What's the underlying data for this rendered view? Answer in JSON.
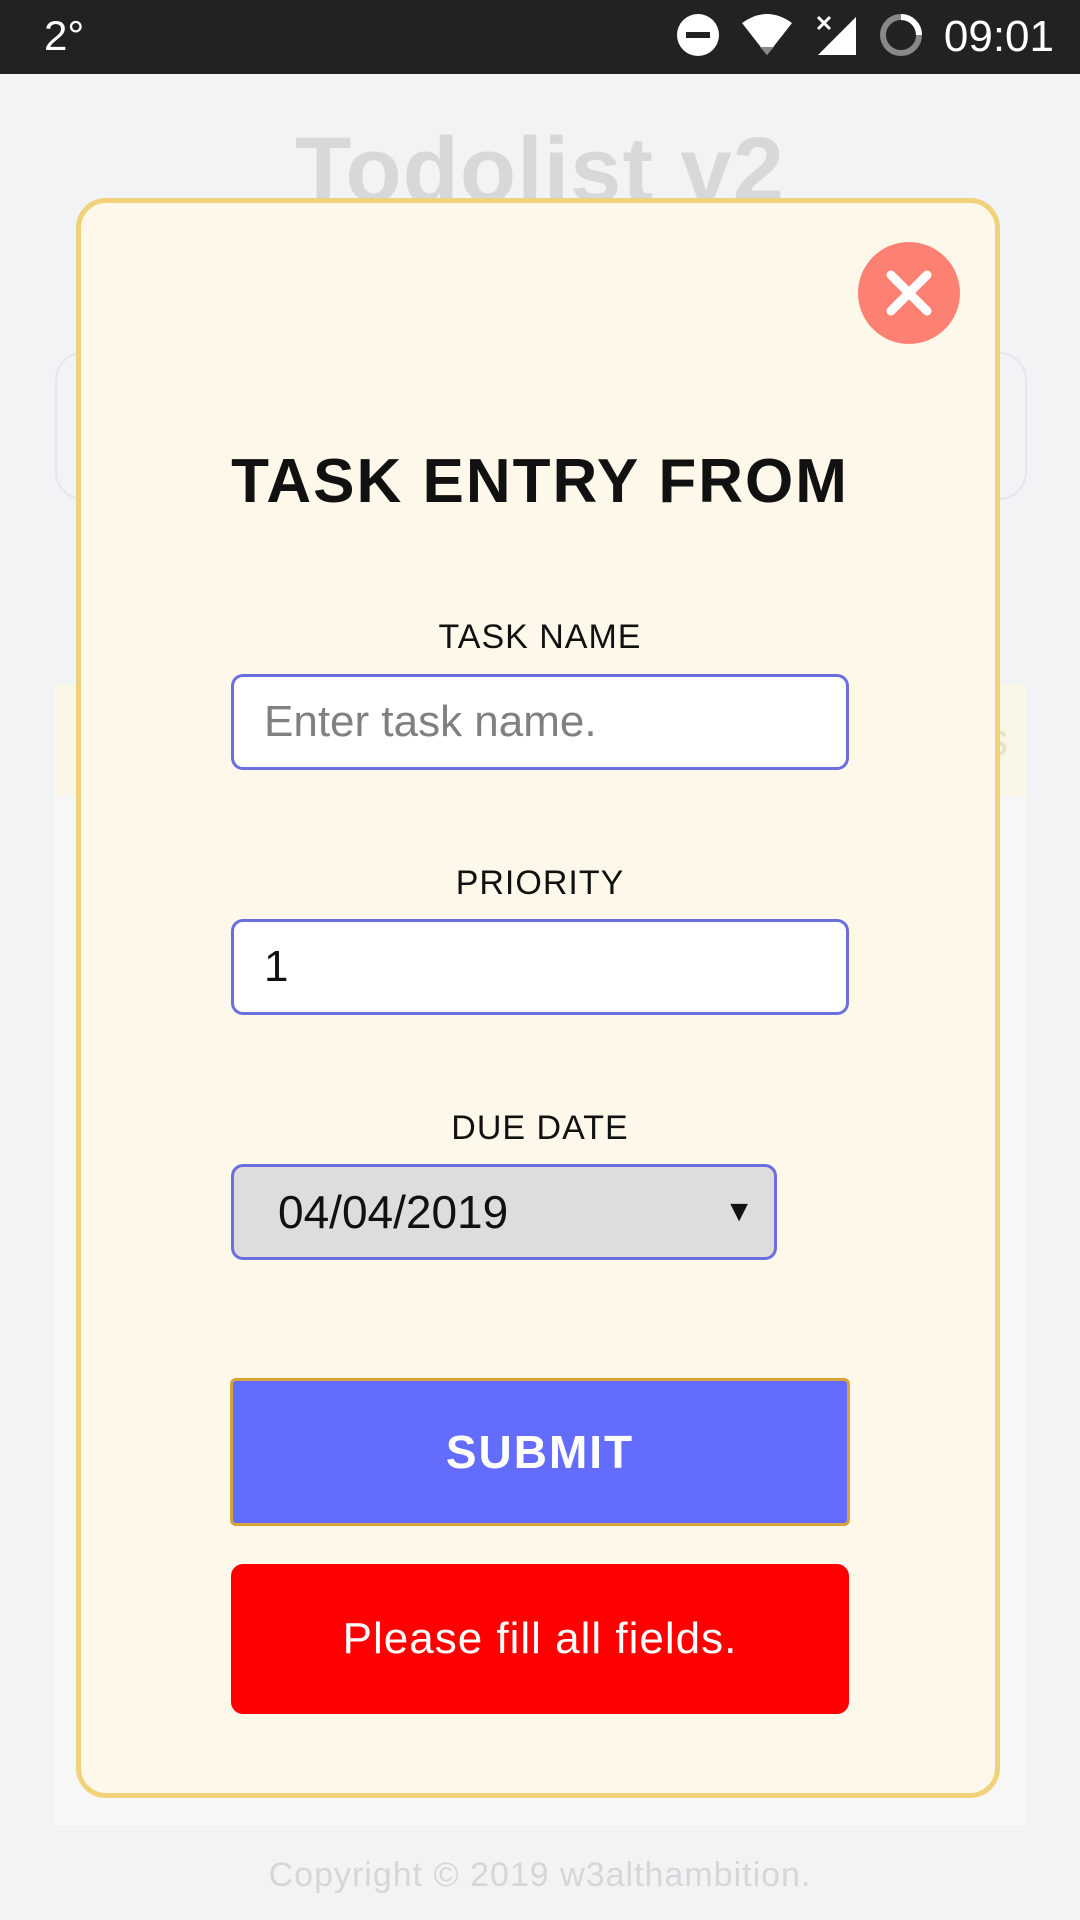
{
  "status_bar": {
    "temperature": "2°",
    "time": "09:01",
    "icons": [
      "do-not-disturb-icon",
      "wifi-icon",
      "no-signal-icon",
      "loading-icon"
    ]
  },
  "background": {
    "title": "Todolist v2",
    "partial_text": "s",
    "footer": "Copyright © 2019 w3althambition."
  },
  "modal": {
    "title": "TASK ENTRY FROM",
    "task_name": {
      "label": "TASK NAME",
      "value": "",
      "placeholder": "Enter task name."
    },
    "priority": {
      "label": "PRIORITY",
      "value": "1"
    },
    "due_date": {
      "label": "DUE DATE",
      "value": "04/04/2019"
    },
    "submit_label": "SUBMIT",
    "error_message": "Please fill all fields."
  },
  "colors": {
    "modal_bg": "#fef8ea",
    "modal_border": "#f1d27a",
    "close_button": "#fd8173",
    "submit_button": "#646cfe",
    "error_bg": "#ff0000",
    "input_border": "#6b6fde"
  }
}
